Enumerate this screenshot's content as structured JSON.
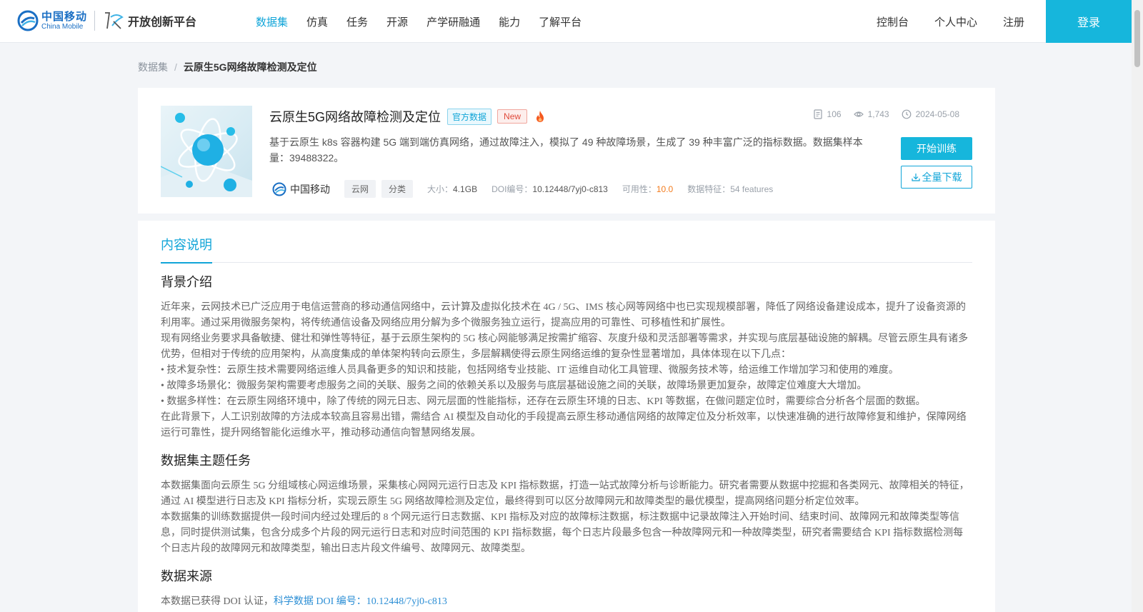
{
  "header": {
    "brand_cn": "中国移动",
    "brand_en": "China Mobile",
    "platform": "开放创新平台",
    "nav": [
      "数据集",
      "仿真",
      "任务",
      "开源",
      "产学研融通",
      "能力",
      "了解平台"
    ],
    "right_nav": [
      "控制台",
      "个人中心",
      "注册"
    ],
    "login": "登录"
  },
  "breadcrumb": {
    "parent": "数据集",
    "separator": "/",
    "current": "云原生5G网络故障检测及定位"
  },
  "dataset": {
    "title": "云原生5G网络故障检测及定位",
    "tag_official": "官方数据",
    "tag_new": "New",
    "stats": {
      "files": "106",
      "views": "1,743",
      "date": "2024-05-08"
    },
    "description": "基于云原生 k8s 容器构建 5G 端到端仿真网络，通过故障注入，模拟了 49 种故障场景，生成了 39 种丰富广泛的指标数据。数据集样本量：39488322。",
    "org": "中国移动",
    "chips": [
      "云网",
      "分类"
    ],
    "size_label": "大小：",
    "size_value": "4.1GB",
    "doi_label": "DOI编号：",
    "doi_value": "10.12448/7yj0-c813",
    "usability_label": "可用性：",
    "usability_value": "10.0",
    "features_label": "数据特征：",
    "features_value": "54 features",
    "btn_train": "开始训练",
    "btn_download": "全量下载"
  },
  "content": {
    "tab": "内容说明",
    "sections": [
      {
        "heading": "背景介绍",
        "paragraphs": [
          "近年来，云网技术已广泛应用于电信运营商的移动通信网络中，云计算及虚拟化技术在 4G / 5G、IMS 核心网等网络中也已实现规模部署，降低了网络设备建设成本，提升了设备资源的利用率。通过采用微服务架构，将传统通信设备及网络应用分解为多个微服务独立运行，提高应用的可靠性、可移植性和扩展性。",
          "现有网络业务要求具备敏捷、健壮和弹性等特征，基于云原生架构的 5G 核心网能够满足按需扩缩容、灰度升级和灵活部署等需求，并实现与底层基础设施的解耦。尽管云原生具有诸多优势，但相对于传统的应用架构，从高度集成的单体架构转向云原生，多层解耦使得云原生网络运维的复杂性显著增加，具体体现在以下几点：",
          "• 技术复杂性：云原生技术需要网络运维人员具备更多的知识和技能，包括网络专业技能、IT 运维自动化工具管理、微服务技术等，给运维工作增加学习和使用的难度。",
          "• 故障多场景化：微服务架构需要考虑服务之间的关联、服务之间的依赖关系以及服务与底层基础设施之间的关联，故障场景更加复杂，故障定位难度大大增加。",
          "• 数据多样性：在云原生网络环境中，除了传统的网元日志、网元层面的性能指标，还存在云原生环境的日志、KPI 等数据，在做问题定位时，需要综合分析各个层面的数据。",
          "在此背景下，人工识别故障的方法成本较高且容易出错，需结合 AI 模型及自动化的手段提高云原生移动通信网络的故障定位及分析效率，以快速准确的进行故障修复和维护，保障网络运行可靠性，提升网络智能化运维水平，推动移动通信向智慧网络发展。"
        ]
      },
      {
        "heading": "数据集主题任务",
        "paragraphs": [
          "本数据集面向云原生 5G 分组域核心网运维场景，采集核心网网元运行日志及 KPI 指标数据，打造一站式故障分析与诊断能力。研究者需要从数据中挖掘和各类网元、故障相关的特征，通过 AI 模型进行日志及 KPI 指标分析，实现云原生 5G 网络故障检测及定位，最终得到可以区分故障网元和故障类型的最优模型，提高网络问题分析定位效率。",
          "本数据集的训练数据提供一段时间内经过处理后的 8 个网元运行日志数据、KPI 指标及对应的故障标注数据，标注数据中记录故障注入开始时间、结束时间、故障网元和故障类型等信息，同时提供测试集，包含分成多个片段的网元运行日志和对应时间范围的 KPI 指标数据，每个日志片段最多包含一种故障网元和一种故障类型，研究者需要结合 KPI 指标数据检测每个日志片段的故障网元和故障类型，输出日志片段文件编号、故障网元、故障类型。"
        ]
      },
      {
        "heading": "数据来源",
        "source_prefix": "本数据已获得 DOI 认证，",
        "source_link": "科学数据 DOI 编号：10.12448/7yj0-c813"
      }
    ]
  }
}
